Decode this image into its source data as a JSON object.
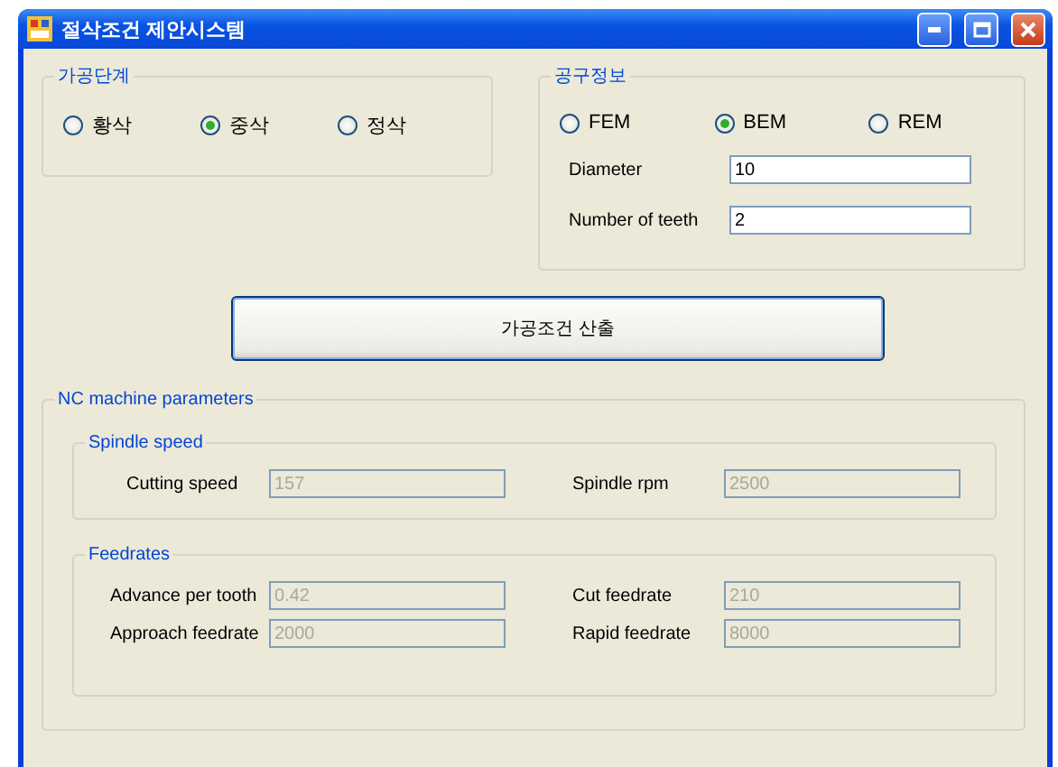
{
  "window": {
    "title": "절삭조건 제안시스템"
  },
  "stage": {
    "title": "가공단계",
    "options": [
      {
        "label": "황삭",
        "selected": false
      },
      {
        "label": "중삭",
        "selected": true
      },
      {
        "label": "정삭",
        "selected": false
      }
    ]
  },
  "tool": {
    "title": "공구정보",
    "options": [
      {
        "label": "FEM",
        "selected": false
      },
      {
        "label": "BEM",
        "selected": true
      },
      {
        "label": "REM",
        "selected": false
      }
    ],
    "fields": [
      {
        "label": "Diameter",
        "value": "10",
        "disabled": false
      },
      {
        "label": "Number of teeth",
        "value": "2",
        "disabled": false
      }
    ]
  },
  "action_button": "가공조건 산출",
  "nc": {
    "title": "NC machine parameters",
    "sections": [
      {
        "title": "Spindle speed",
        "fields": [
          {
            "label": "Cutting speed",
            "value": "157",
            "disabled": true
          },
          {
            "label": "Spindle rpm",
            "value": "2500",
            "disabled": true
          }
        ]
      },
      {
        "title": "Feedrates",
        "fields": [
          {
            "label": "Advance per tooth",
            "value": "0.42",
            "disabled": true
          },
          {
            "label": "Cut feedrate",
            "value": "210",
            "disabled": true
          },
          {
            "label": "Approach feedrate",
            "value": "2000",
            "disabled": true
          },
          {
            "label": "Rapid feedrate",
            "value": "8000",
            "disabled": true
          }
        ]
      }
    ]
  }
}
